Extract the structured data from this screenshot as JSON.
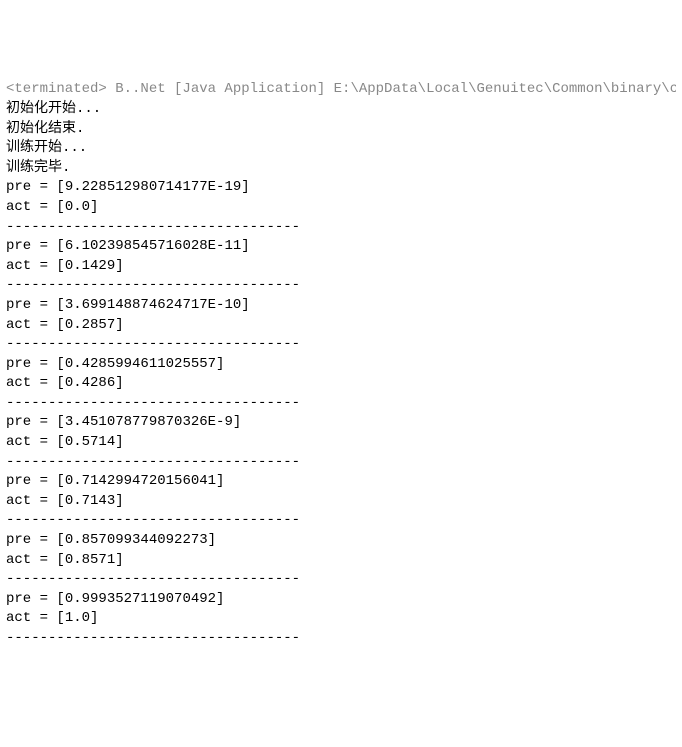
{
  "header": "<terminated>  B..Net [Java Application] E:\\AppData\\Local\\Genuitec\\Common\\binary\\com.sun",
  "status_lines": [
    "初始化开始...",
    "初始化结束.",
    "训练开始...",
    "训练完毕."
  ],
  "separator": "-----------------------------------",
  "results": [
    {
      "pre": "[9.228512980714177E-19]",
      "act": "[0.0]"
    },
    {
      "pre": "[6.102398545716028E-11]",
      "act": "[0.1429]"
    },
    {
      "pre": "[3.699148874624717E-10]",
      "act": "[0.2857]"
    },
    {
      "pre": "[0.4285994611025557]",
      "act": "[0.4286]"
    },
    {
      "pre": "[3.451078779870326E-9]",
      "act": "[0.5714]"
    },
    {
      "pre": "[0.7142994720156041]",
      "act": "[0.7143]"
    },
    {
      "pre": "[0.857099344092273]",
      "act": "[0.8571]"
    },
    {
      "pre": "[0.9993527119070492]",
      "act": "[1.0]"
    }
  ],
  "labels": {
    "pre_prefix": "pre = ",
    "act_prefix": "act = "
  }
}
